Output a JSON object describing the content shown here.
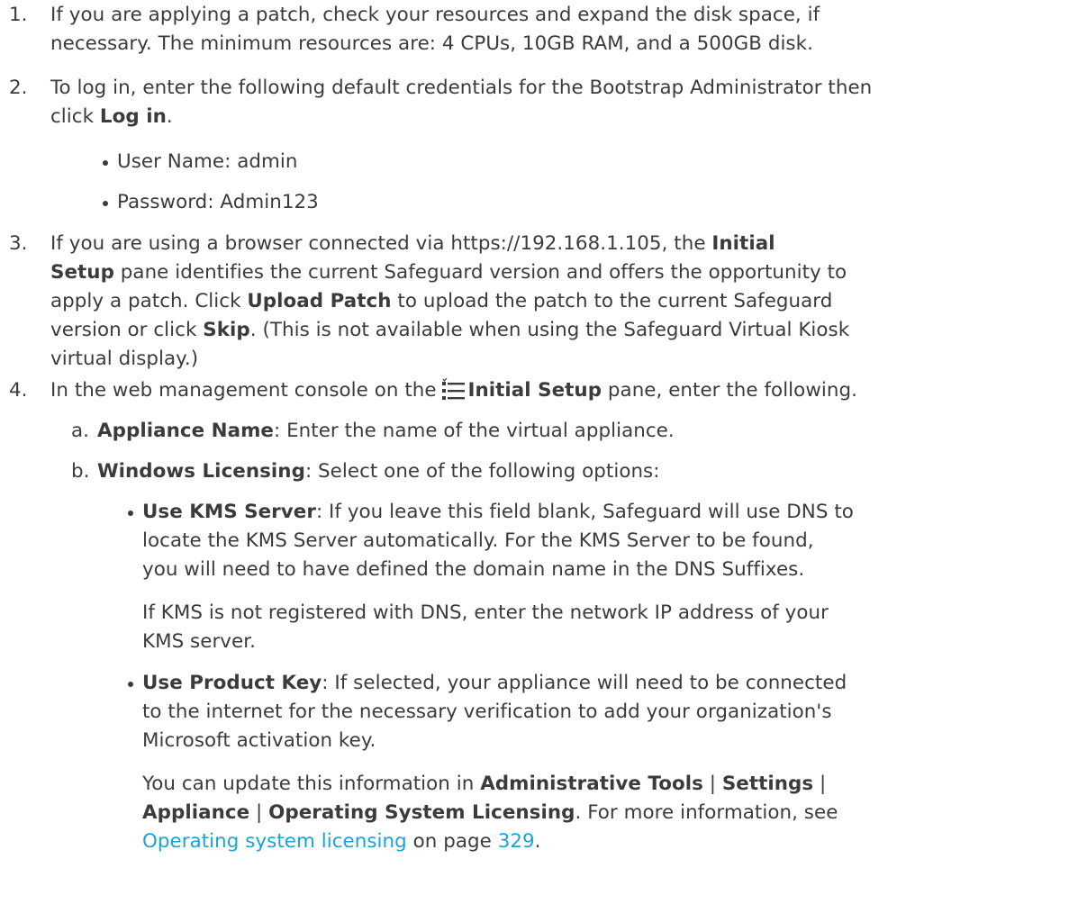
{
  "step1": {
    "num": "1.",
    "line1": "If you are applying a patch, check your resources and expand the disk space, if",
    "line2": "necessary. The minimum resources are: 4 CPUs, 10GB RAM, and a 500GB disk."
  },
  "step2": {
    "num": "2.",
    "line1": "To log in, enter the following default credentials for the Bootstrap Administrator then",
    "click": "click ",
    "login": "Log in",
    "period": ".",
    "user": "User Name: admin",
    "password": "Password: Admin123"
  },
  "step3": {
    "num": "3.",
    "l1a": "If you are using a browser connected via https://192.168.1.105, the ",
    "l1b": "Initial",
    "l2a": "Setup",
    "l2b": " pane identifies the current Safeguard version and offers the opportunity to",
    "l3": "apply a patch. Click ",
    "l3b": "Upload Patch",
    "l3c": " to upload the patch to the current Safeguard",
    "l4a": "version or click ",
    "l4b": "Skip",
    "l4c": ". (This is not available when using the Safeguard Virtual Kiosk",
    "l5": "virtual display.)"
  },
  "step4": {
    "num": "4.",
    "pre": "In the web management console on the ",
    "bold": "Initial Setup",
    "post": " pane, enter the following.",
    "a_letter": "a.",
    "a_bold": "Appliance Name",
    "a_text": ": Enter the name of the virtual appliance.",
    "b_letter": "b.",
    "b_bold": "Windows Licensing",
    "b_text": ": Select one of the following options:",
    "kms_bold": "Use KMS Server",
    "kms_l1": ": If you leave this field blank, Safeguard will use DNS to",
    "kms_l2": "locate the KMS Server automatically. For the KMS Server to be found,",
    "kms_l3": "you will need to have defined the domain name in the DNS Suffixes.",
    "kms_p2_l1": "If KMS is not registered with DNS, enter the network IP address of your",
    "kms_p2_l2": "KMS server.",
    "pk_bold": "Use Product Key",
    "pk_l1": ": If selected, your appliance will need to be connected",
    "pk_l2": "to the internet for the necessary verification to add your organization's",
    "pk_l3": "Microsoft activation key.",
    "upd_a": "You can update this information in ",
    "upd_b": "Administrative Tools",
    "sep": " | ",
    "upd_c": "Settings",
    "upd_d": "Appliance",
    "upd_e": "Operating System Licensing",
    "upd_f": ". For more information, see",
    "link": "Operating system licensing",
    "on_page": " on page ",
    "page": "329",
    "end": "."
  },
  "colors": {
    "text": "#3b3b3b",
    "link": "#1aa3d9"
  },
  "icons": {
    "initial_setup": "checklist-icon"
  }
}
